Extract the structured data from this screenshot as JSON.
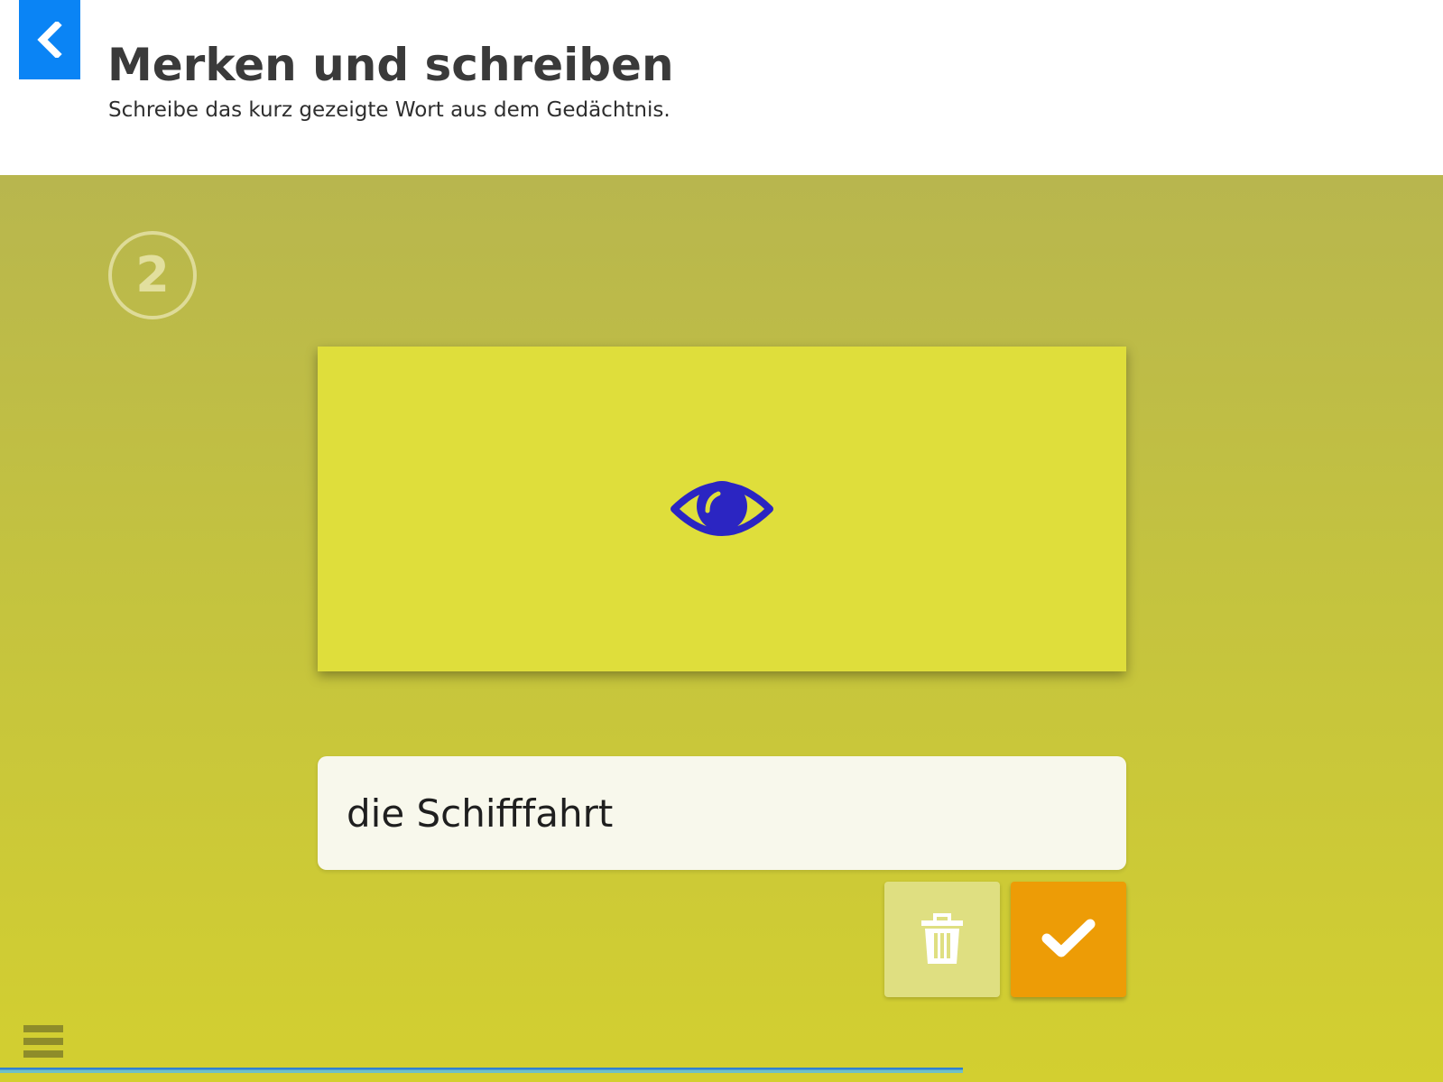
{
  "header": {
    "title": "Merken und schreiben",
    "subtitle": "Schreibe das kurz gezeigte Wort aus dem Gedächtnis.",
    "back_icon": "chevron-left-icon"
  },
  "exercise": {
    "step_number": "2",
    "card_icon": "eye-icon",
    "answer_value": "die Schifffahrt",
    "delete_icon": "trash-icon",
    "confirm_icon": "checkmark-icon",
    "progress_fraction": 0.667
  },
  "footer": {
    "menu_icon": "hamburger-menu-icon"
  },
  "colors": {
    "accent_blue": "#0a84f5",
    "eye": "#2b25c2",
    "card": "#dfde3b",
    "confirm": "#ed9c06",
    "delete": "#dfdf81"
  }
}
